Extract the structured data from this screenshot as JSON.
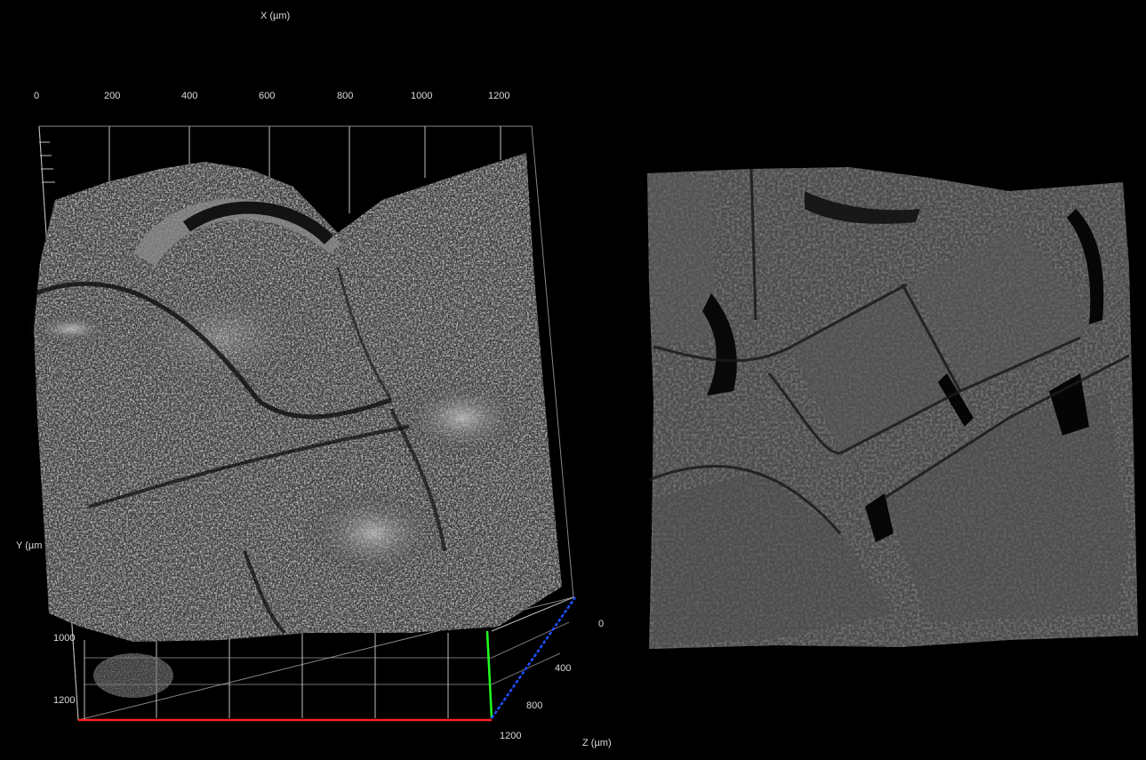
{
  "left_view": {
    "x_axis": {
      "title": "X (µm)",
      "ticks": [
        "0",
        "200",
        "400",
        "600",
        "800",
        "1000",
        "1200"
      ]
    },
    "y_axis": {
      "title": "Y (µm",
      "ticks": [
        "1000",
        "1200"
      ]
    },
    "z_axis": {
      "title": "Z (µm)",
      "ticks": [
        "0",
        "400",
        "800",
        "1200"
      ]
    },
    "axis_colors": {
      "x": "#ff2020",
      "y": "#20ff20",
      "z": "#2050ff"
    }
  }
}
